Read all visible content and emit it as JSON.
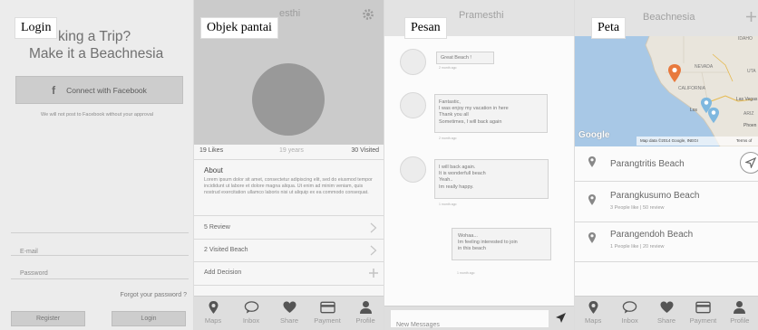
{
  "login": {
    "caption": "Login",
    "headline_1": "king a Trip?",
    "headline_2": "Make it a Beachnesia",
    "facebook_button": "Connect with Facebook",
    "facebook_icon_glyph": "f",
    "disclaimer": "We will not post to Facebook without your approval",
    "email_placeholder": "E-mail",
    "password_placeholder": "Password",
    "forgot_password": "Forgot your password ?",
    "register_button": "Register",
    "login_button": "Login"
  },
  "beach_object": {
    "caption": "Objek pantai",
    "title_fragment": "esthi",
    "gear_icon": "gear-icon",
    "stats": {
      "likes": "19 Likes",
      "years": "19 years",
      "visited": "30 Visited"
    },
    "about_heading": "About",
    "about_text": "Lorem ipsum dolor sit amet, consectetur adipiscing elit, sed do eiusmod tempor incididunt ut labore et dolore magna aliqua. Ut enim ad minim veniam, quis nostrud exercitation ullamco laboris nisi ut aliquip ex ea commodo consequat.",
    "menu": [
      {
        "label": "5 Review",
        "icon": "chevron-right-icon"
      },
      {
        "label": "2 Visited Beach",
        "icon": "chevron-right-icon"
      },
      {
        "label": "Add Decision",
        "icon": "plus-icon"
      }
    ]
  },
  "messages": {
    "caption": "Pesan",
    "title": "Pramesthi",
    "items": [
      {
        "text": "Great Beach !",
        "time": "2 month ago"
      },
      {
        "text": "Fantastic,\nI was enjoy my vacation in here\nThank you all\nSometimes, I will back again",
        "time": "2 month ago"
      },
      {
        "text": "I will back again.\nIt is wonderfull beach\nYeah..\nIm really happy.",
        "time": "1 month ago"
      },
      {
        "text": "Wohaa...\nIm feeling interested to join\nin this beach",
        "time": "1 month ago"
      }
    ],
    "input_placeholder": "New Messages",
    "send_icon": "send-icon"
  },
  "map": {
    "caption": "Peta",
    "title": "Beachnesia",
    "add_icon": "plus-icon",
    "labels": {
      "idaho": "IDAHO",
      "nevada": "NEVADA",
      "california": "CALIFORNIA",
      "las_vegas": "Las Vegas",
      "los": "Los",
      "arizona": "ARIZ",
      "phoenix": "Phoen",
      "uta": "UTA"
    },
    "google_logo": "Google",
    "attribution": "Map data ©2014 Google, INEGI",
    "terms": "Terms of",
    "colors": {
      "primary_pin": "#e8793d",
      "secondary_pin": "#7fb8df",
      "water": "#a8c8e6",
      "land": "#e9e5dc"
    },
    "list": [
      {
        "name": "Parangtritis Beach",
        "meta": ""
      },
      {
        "name": "Parangkusumo Beach",
        "meta": "3 People like | 50 review"
      },
      {
        "name": "Parangendoh Beach",
        "meta": "1 People like | 20 review"
      }
    ]
  },
  "tabbar": [
    {
      "label": "Maps",
      "icon": "map-pin-icon"
    },
    {
      "label": "Inbox",
      "icon": "chat-icon"
    },
    {
      "label": "Share",
      "icon": "heart-icon"
    },
    {
      "label": "Payment",
      "icon": "card-icon"
    },
    {
      "label": "Profile",
      "icon": "user-icon"
    }
  ]
}
